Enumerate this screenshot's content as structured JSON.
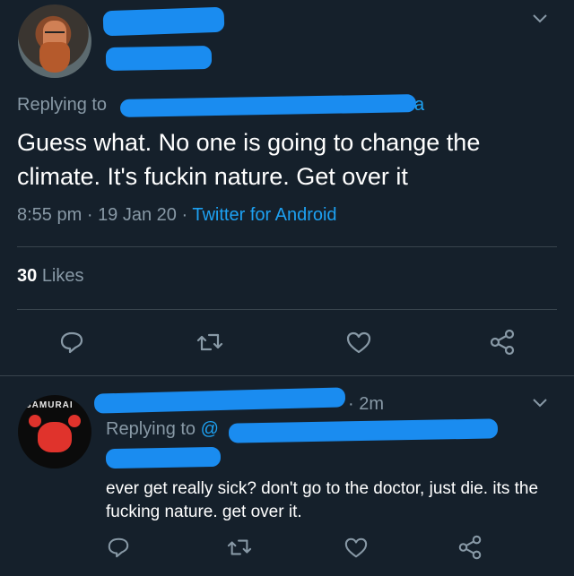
{
  "main_tweet": {
    "replying_to_label": "Replying to",
    "replying_to_visible": "a",
    "text": "Guess what. No one is going to change the climate. It's fuckin nature. Get over it",
    "time": "8:55 pm",
    "sep1": "·",
    "date": "19 Jan 20",
    "sep2": "·",
    "source": "Twitter for Android",
    "likes_count": "30",
    "likes_label": "Likes"
  },
  "reply_tweet": {
    "avatar_brand": "SAMURAI",
    "time_ago": "· 2m",
    "replying_to_label": "Replying to",
    "replying_to_at": "@",
    "text": "ever get really sick? don't go to the doctor, just die. its the fucking nature. get over it."
  },
  "icons": {
    "reply": "reply-icon",
    "retweet": "retweet-icon",
    "like": "heart-icon",
    "share": "share-icon",
    "more": "chevron-down-icon"
  },
  "colors": {
    "background": "#15202b",
    "text": "#ffffff",
    "muted": "#8899a6",
    "link": "#1da1f2",
    "divider": "#38444d"
  }
}
